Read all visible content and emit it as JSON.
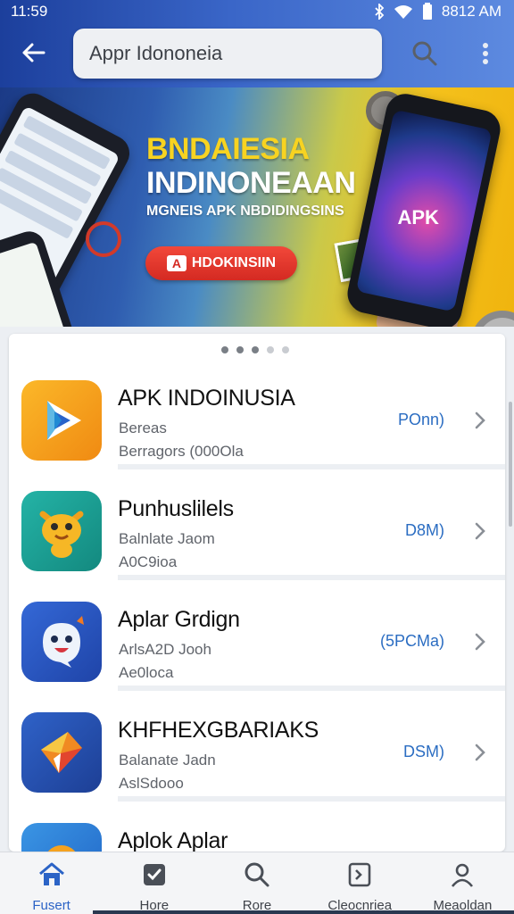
{
  "status_bar": {
    "time": "11:59",
    "clock_right": "8812 AM",
    "icons": [
      "bluetooth-icon",
      "wifi-icon",
      "battery-icon"
    ]
  },
  "app_bar": {
    "back_icon": "arrow-left-icon",
    "search_text": "Appr Idononeia",
    "search_icon": "search-icon",
    "menu_icon": "more-vertical-icon"
  },
  "banner": {
    "title_line1": "BNDAIESIA",
    "title_line2": "INDINONEAAN",
    "subtitle": "MGNEIS APK NBDIDINGSINS",
    "cta_label": "HDOKINSIIN",
    "cta_icon_letter": "A",
    "phone_label": "APK"
  },
  "carousel": {
    "dot_count": 5,
    "active_dots": 3
  },
  "apps": [
    {
      "name": "APK INDOINUSIA",
      "line1": "Bereas",
      "line2": "Berragors (000Ola",
      "size": "POnn)",
      "icon": "play-triangle-icon",
      "icon_bg": "#f7a21b"
    },
    {
      "name": "Punhuslilels",
      "line1": "Balnlate Jaom",
      "line2": "A0C9ioa",
      "size": "D8M)",
      "icon": "monster-mascot-icon",
      "icon_bg": "#1fa699"
    },
    {
      "name": "Aplar Grdign",
      "line1": "ArlsA2D Jooh",
      "line2": "Ae0loca",
      "size": "(5PCMa)",
      "icon": "ghost-face-icon",
      "icon_bg": "#2b5bc9"
    },
    {
      "name": "KHFHEXGBARIAKS",
      "line1": "Balanate Jadn",
      "line2": "AslSdooo",
      "size": "DSM)",
      "icon": "paper-plane-icon",
      "icon_bg": "#2c56b8"
    },
    {
      "name": "Aplok Aplar",
      "line1": "",
      "line2": "",
      "size": "",
      "icon": "arrow-badge-icon",
      "icon_bg": "#2f86d8"
    }
  ],
  "bottom_nav": [
    {
      "label": "Fusert",
      "icon": "home-icon",
      "active": true
    },
    {
      "label": "Hore",
      "icon": "checkbox-icon",
      "active": false
    },
    {
      "label": "Rore",
      "icon": "search-icon",
      "active": false
    },
    {
      "label": "Cleocnriea",
      "icon": "bookmark-box-icon",
      "active": false
    },
    {
      "label": "Meaoldan",
      "icon": "profile-icon",
      "active": false
    }
  ],
  "colors": {
    "accent": "#2b63c6",
    "header": "#1c3f9c",
    "size_text": "#2b6dc2"
  }
}
